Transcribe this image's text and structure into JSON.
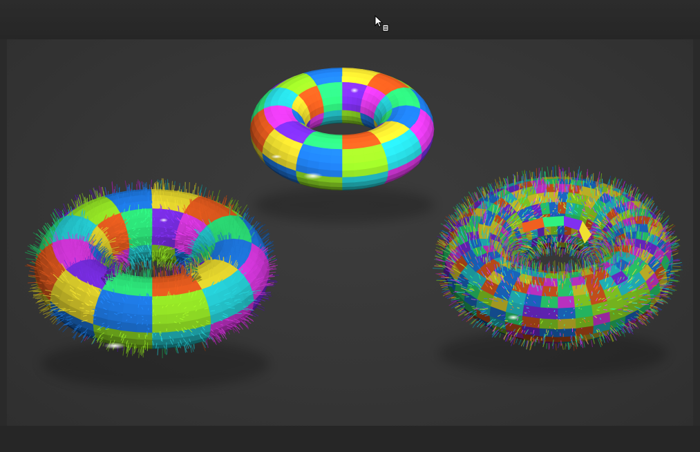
{
  "viewport": {
    "objects": [
      {
        "name": "glossy-checker-torus",
        "shading": "glossy",
        "fur": false
      },
      {
        "name": "furry-checker-torus",
        "shading": "fur",
        "fur": true
      },
      {
        "name": "noise-fur-torus",
        "shading": "fur-random-color",
        "fur": true
      }
    ]
  },
  "colors": {
    "background": "#2a2a2a",
    "viewport": "#373737",
    "checker": [
      "#e83cf0",
      "#28d8e0",
      "#9cf028",
      "#2080f0",
      "#f0e030",
      "#f06020",
      "#30f080",
      "#8030f0"
    ]
  },
  "cursor": {
    "icon": "context-menu-pointer-icon"
  }
}
